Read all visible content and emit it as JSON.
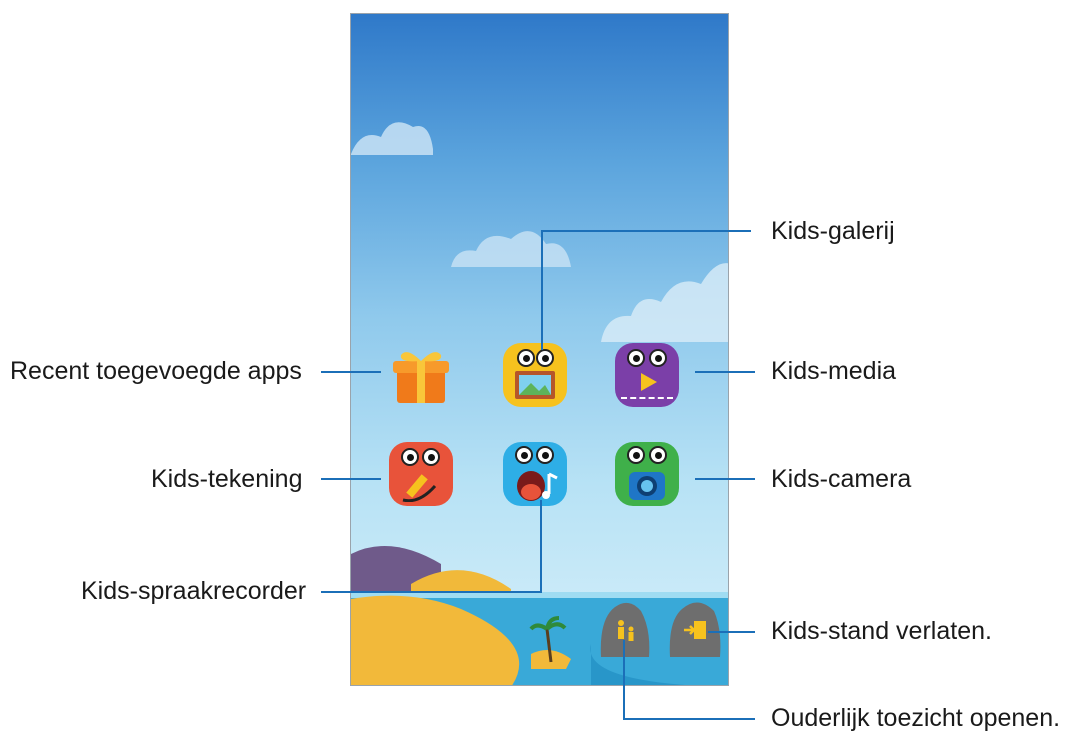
{
  "callouts": {
    "kids_gallery": "Kids-galerij",
    "recent_apps": "Recent toegevoegde apps",
    "kids_media": "Kids-media",
    "kids_drawing": "Kids-tekening",
    "kids_camera": "Kids-camera",
    "kids_voice_recorder": "Kids-spraakrecorder",
    "exit_kids_mode": "Kids-stand verlaten.",
    "parental_control": "Ouderlijk toezicht openen."
  },
  "icons": {
    "recent_apps": "gift-icon",
    "kids_gallery": "picture-frame-icon",
    "kids_media": "play-icon",
    "kids_drawing": "pencil-icon",
    "kids_voice_recorder": "music-note-icon",
    "kids_camera": "camera-icon",
    "parental_control": "parent-child-icon",
    "exit_kids_mode": "exit-door-icon"
  },
  "colors": {
    "callout_line": "#1b6fb8",
    "sky_top": "#2f79c9",
    "sky_bottom": "#d8f0fa"
  }
}
